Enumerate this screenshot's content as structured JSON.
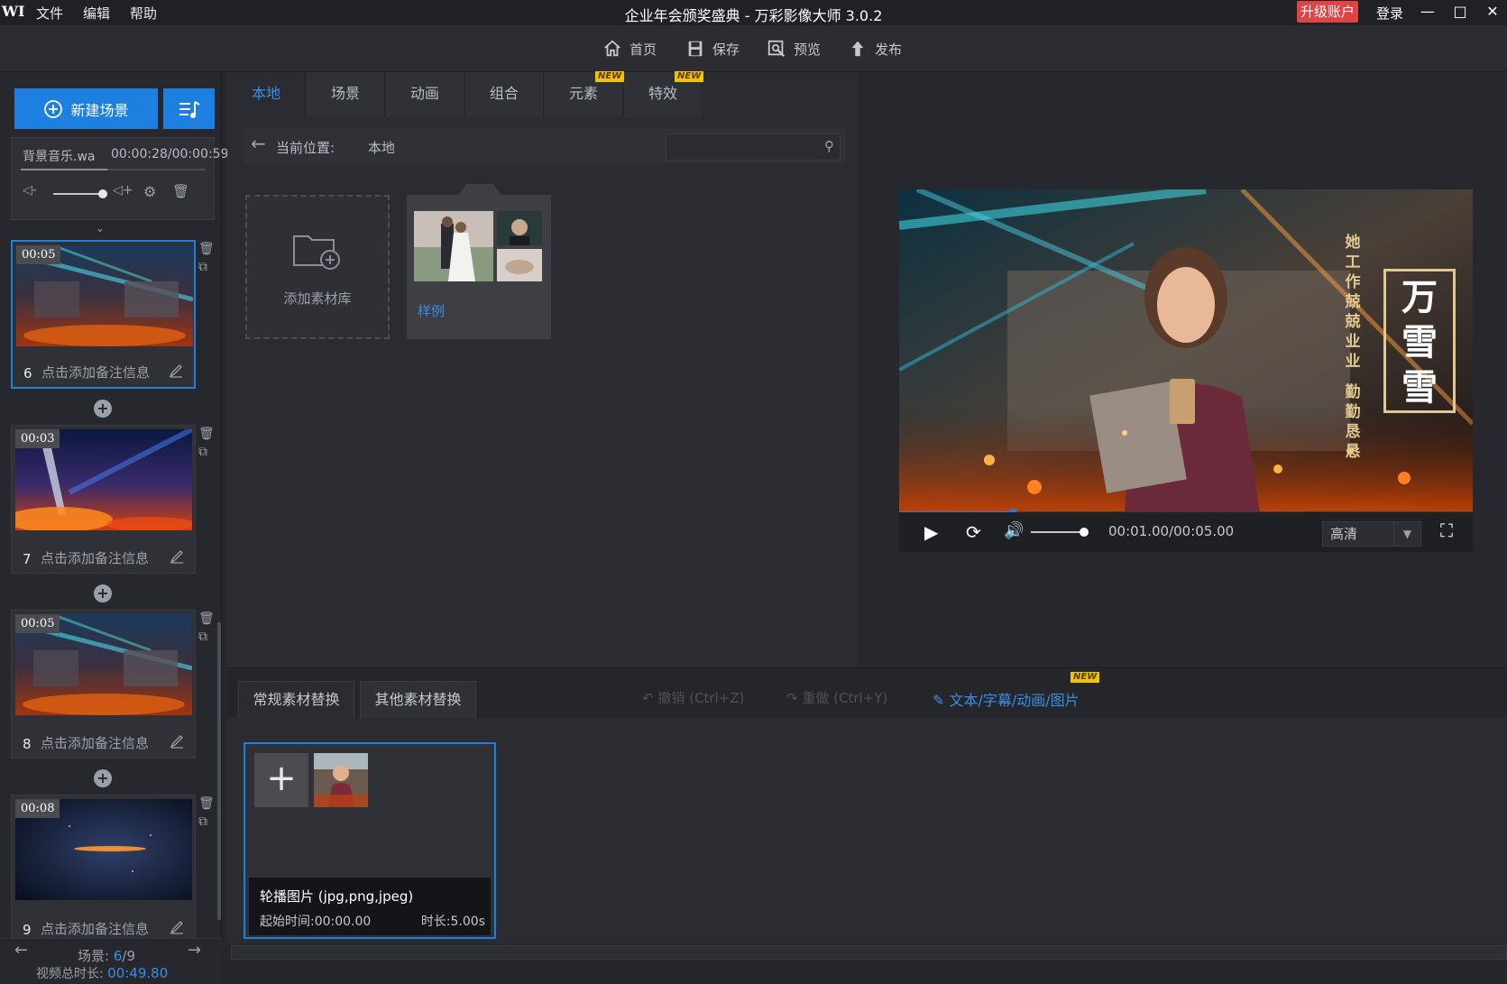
{
  "app": {
    "logo_text": "WI",
    "title": "企业年会颁奖盛典 - 万彩影像大师 3.0.2",
    "menus": [
      "文件",
      "编辑",
      "帮助"
    ],
    "upgrade_label": "升级账户",
    "login_label": "登录"
  },
  "toolbar": {
    "home": "首页",
    "save": "保存",
    "preview": "预览",
    "publish": "发布"
  },
  "left": {
    "new_scene_label": "新建场景",
    "music": {
      "name": "背景音乐.wa",
      "time": "00:00:28/00:00:59",
      "volume_level": 0.9
    },
    "scenes": [
      {
        "number": "6",
        "duration": "00:05",
        "note": "点击添加备注信息",
        "selected": true,
        "thumb": "concert-stage-aurora"
      },
      {
        "number": "7",
        "duration": "00:03",
        "note": "点击添加备注信息",
        "selected": false,
        "thumb": "trophy-sparkles"
      },
      {
        "number": "8",
        "duration": "00:05",
        "note": "点击添加备注信息",
        "selected": false,
        "thumb": "concert-stage-aurora"
      },
      {
        "number": "9",
        "duration": "00:08",
        "note": "点击添加备注信息",
        "selected": false,
        "thumb": "dark-blue-glow"
      }
    ],
    "footer": {
      "scene_label": "场景:",
      "scene_current": "6",
      "scene_total": "/9",
      "total_label": "视频总时长:",
      "total_value": "00:49.80"
    }
  },
  "library": {
    "tabs": [
      {
        "label": "本地",
        "active": true,
        "new": false
      },
      {
        "label": "场景",
        "active": false,
        "new": false
      },
      {
        "label": "动画",
        "active": false,
        "new": false
      },
      {
        "label": "组合",
        "active": false,
        "new": false
      },
      {
        "label": "元素",
        "active": false,
        "new": true
      },
      {
        "label": "特效",
        "active": false,
        "new": true
      }
    ],
    "new_badge": "NEW",
    "path_label": "当前位置:",
    "path_value": "本地",
    "search_placeholder": "",
    "add_library_label": "添加素材库",
    "sample_label": "样例"
  },
  "preview": {
    "time": "00:01.00/00:05.00",
    "progress": 0.2,
    "volume": 0.95,
    "quality": "高清",
    "video_text": {
      "vertical_line": [
        "她",
        "工",
        "作",
        "兢",
        "兢",
        "业",
        "业",
        "",
        "勤",
        "勤",
        "恳",
        "恳"
      ],
      "name_chars": [
        "万",
        "雪",
        "雪"
      ]
    }
  },
  "bottom": {
    "tabs": [
      "常规素材替换",
      "其他素材替换"
    ],
    "undo": "撤销 (Ctrl+Z)",
    "redo": "重做 (Ctrl+Y)",
    "text_edit": "文本/字幕/动画/图片",
    "new_badge": "NEW",
    "card": {
      "title": "轮播图片 (jpg,png,jpeg)",
      "start": "起始时间:00:00.00",
      "duration": "时长:5.00s"
    }
  },
  "colors": {
    "accent": "#1d7fe0",
    "upgrade": "#e04343",
    "new_badge": "#f0c400",
    "background": "#25272c"
  }
}
